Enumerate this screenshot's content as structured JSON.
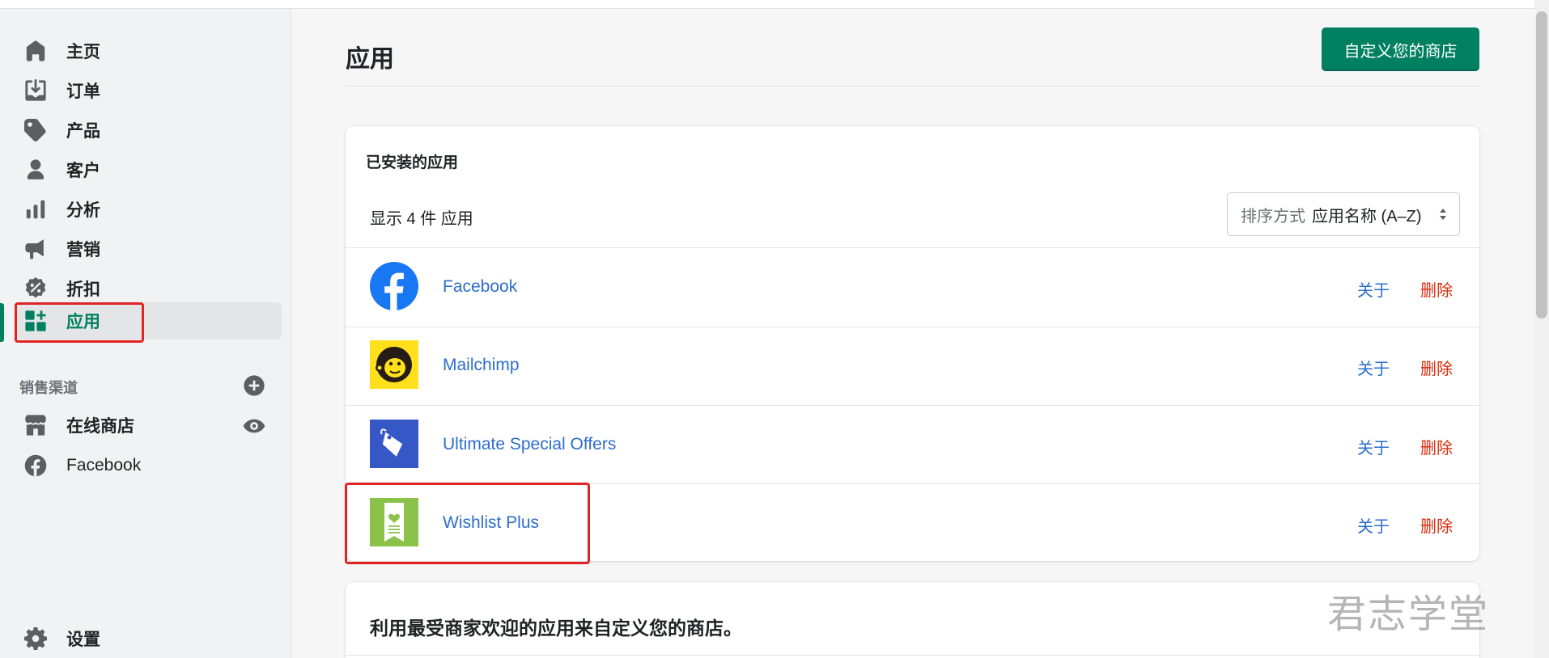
{
  "sidebar": {
    "items": [
      {
        "label": "主页",
        "icon": "home-icon"
      },
      {
        "label": "订单",
        "icon": "orders-icon"
      },
      {
        "label": "产品",
        "icon": "tag-icon"
      },
      {
        "label": "客户",
        "icon": "person-icon"
      },
      {
        "label": "分析",
        "icon": "bar-chart-icon"
      },
      {
        "label": "营销",
        "icon": "megaphone-icon"
      },
      {
        "label": "折扣",
        "icon": "discount-icon"
      },
      {
        "label": "应用",
        "icon": "apps-icon",
        "active": true
      }
    ],
    "channels_title": "销售渠道",
    "channels": [
      {
        "label": "在线商店",
        "icon": "store-icon"
      },
      {
        "label": "Facebook",
        "icon": "facebook-icon"
      }
    ],
    "settings": {
      "label": "设置",
      "icon": "gear-icon"
    }
  },
  "main": {
    "title": "应用",
    "customize_button": "自定义您的商店",
    "installed": {
      "title": "已安装的应用",
      "count_text": "显示 4 件 应用",
      "sort_prefix": "排序方式",
      "sort_value": "应用名称 (A–Z)",
      "apps": [
        {
          "name": "Facebook",
          "about": "关于",
          "delete": "删除",
          "logo": "facebook-logo"
        },
        {
          "name": "Mailchimp",
          "about": "关于",
          "delete": "删除",
          "logo": "mailchimp-logo"
        },
        {
          "name": "Ultimate Special Offers",
          "about": "关于",
          "delete": "删除",
          "logo": "tag-logo"
        },
        {
          "name": "Wishlist Plus",
          "about": "关于",
          "delete": "删除",
          "logo": "wishlist-logo"
        }
      ]
    },
    "recommend_title": "利用最受商家欢迎的应用来自定义您的商店。"
  },
  "watermark": "君志学堂",
  "colors": {
    "accent": "#008060",
    "link": "#2c6ecb",
    "danger": "#d82c0d",
    "highlight": "#e02424"
  }
}
